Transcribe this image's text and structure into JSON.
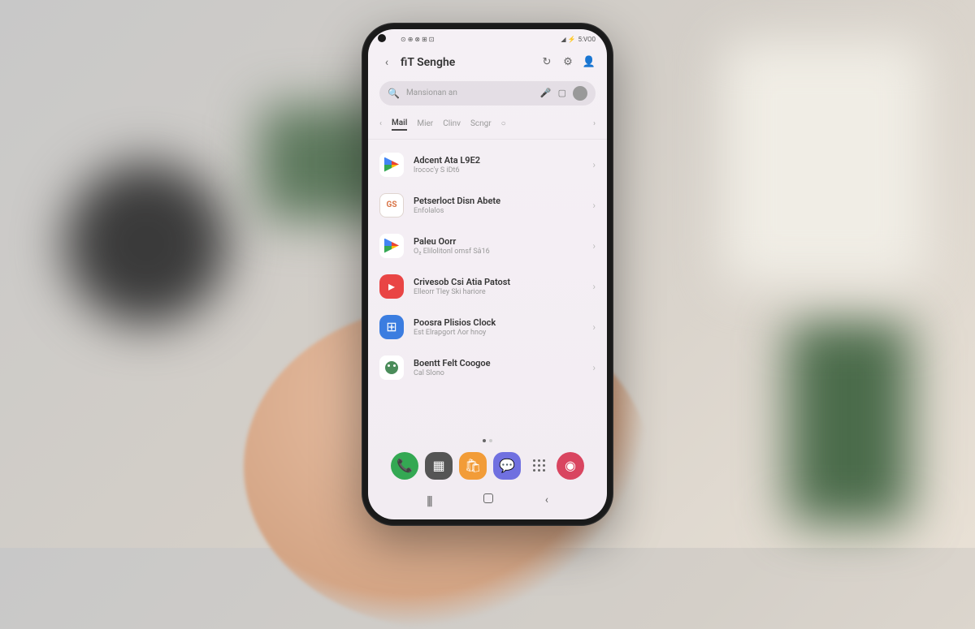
{
  "status": {
    "left_icons": "⊙ ⊕ ⊗ ⊞ ⊡",
    "right_icons": "◢ ⚡",
    "time": "5:VO0"
  },
  "header": {
    "title": "fiT Senghe",
    "icons": {
      "sync": "sync-icon",
      "settings": "settings-icon",
      "profile": "profile-icon"
    }
  },
  "search": {
    "placeholder": "Mansionan an"
  },
  "tabs": {
    "items": [
      "Mail",
      "Mier",
      "Clinv",
      "Scngr"
    ],
    "active_index": 0
  },
  "list": {
    "items": [
      {
        "icon": "play-store-icon",
        "title": "Adcent Ata L9E2",
        "subtitle": "lrococ'y S iDt6"
      },
      {
        "icon": "gs-icon",
        "title": "Petserloct Disn Abete",
        "subtitle": "Enfolalos"
      },
      {
        "icon": "play-store-icon",
        "title": "Paleu Oorr",
        "subtitle": "O₂ Elilolitonl omsf Sâ16"
      },
      {
        "icon": "red-app-icon",
        "title": "Crivesob Csi Atia Patost",
        "subtitle": "Elleorr Tley Ski hariore"
      },
      {
        "icon": "blue-app-icon",
        "title": "Poosra Plisios Clock",
        "subtitle": "Est Elrapgort Λor hnoy"
      },
      {
        "icon": "bot-icon",
        "title": "Boentt Felt Coogoe",
        "subtitle": "Cal Slono"
      }
    ]
  },
  "dock": {
    "items": [
      "phone",
      "apps",
      "store",
      "messages",
      "grid",
      "camera"
    ]
  }
}
